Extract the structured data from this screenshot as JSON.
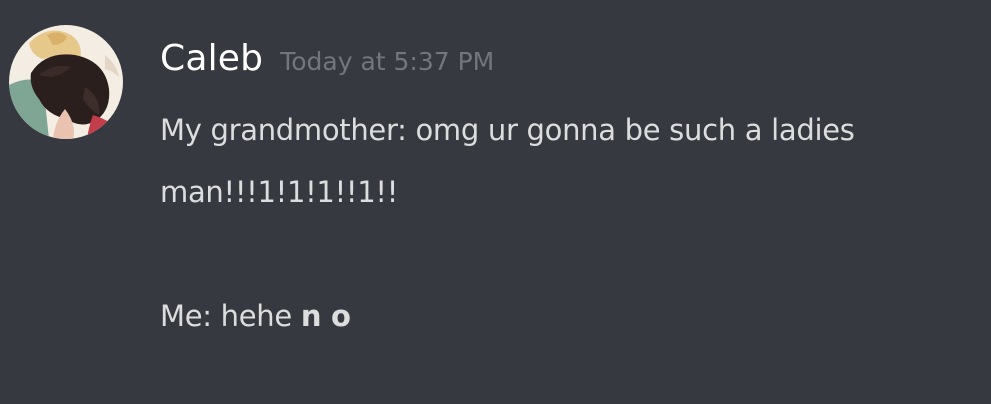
{
  "message": {
    "author": "Caleb",
    "timestamp": "Today at 5:37 PM",
    "avatar_icon": "user-avatar",
    "lines": {
      "line1": "My grandmother: omg ur gonna be such a ladies",
      "line2": "man!!!1!1!1!!1!!",
      "line3_prefix": "Me: hehe ",
      "line3_bold": "n o"
    }
  },
  "colors": {
    "background": "#36393f",
    "username": "#ffffff",
    "timestamp": "#72767d",
    "text": "#dcddde"
  }
}
